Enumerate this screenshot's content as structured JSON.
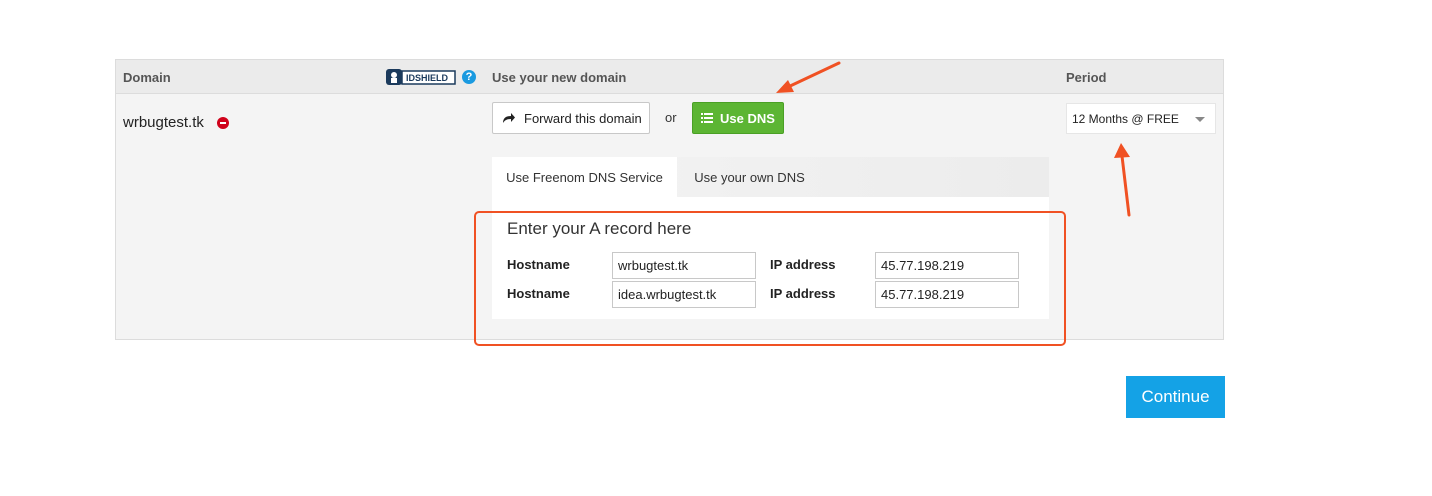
{
  "table": {
    "header": {
      "domain": "Domain",
      "idshield_logo_text": "IDSHIELD",
      "help_icon": "?",
      "use_new_domain": "Use your new domain",
      "period": "Period"
    },
    "row": {
      "domain_name": "wrbugtest.tk",
      "forward_button": "Forward this domain",
      "or_text": "or",
      "use_dns_button": "Use DNS",
      "period_value": "12 Months @ FREE"
    }
  },
  "dns": {
    "tabs": [
      {
        "label": "Use Freenom DNS Service",
        "active": true
      },
      {
        "label": "Use your own DNS",
        "active": false
      }
    ],
    "title": "Enter your A record here",
    "records": [
      {
        "hostname_label": "Hostname",
        "hostname": "wrbugtest.tk",
        "ip_label": "IP address",
        "ip": "45.77.198.219"
      },
      {
        "hostname_label": "Hostname",
        "hostname": "idea.wrbugtest.tk",
        "ip_label": "IP address",
        "ip": "45.77.198.219"
      }
    ]
  },
  "continue_button": "Continue",
  "colors": {
    "accent_green": "#5cb533",
    "accent_blue": "#14a2e6",
    "annotation_orange": "#f05123"
  },
  "icons": [
    "idshield-logo-icon",
    "help-icon",
    "remove-icon",
    "forward-arrow-icon",
    "list-icon",
    "chevron-down-icon"
  ]
}
